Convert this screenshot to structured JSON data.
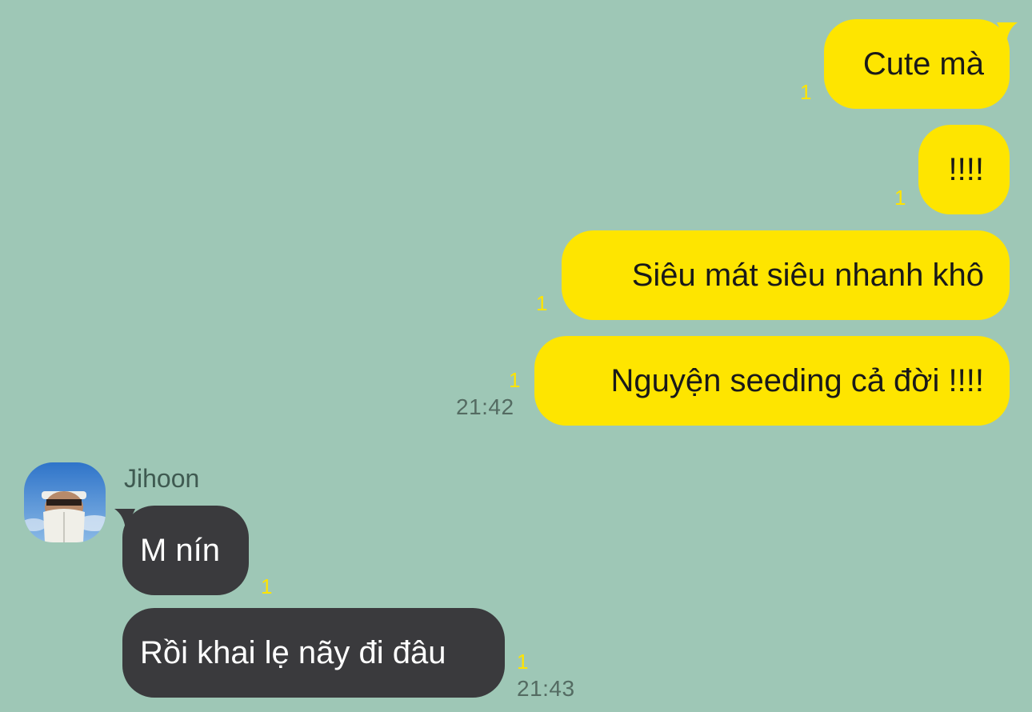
{
  "colors": {
    "background": "#9ec7b6",
    "outgoing_bubble": "#fee500",
    "incoming_bubble": "#3a3a3d",
    "read_count": "#ffe400",
    "timestamp": "#546b62"
  },
  "outgoing": [
    {
      "text": "Cute mà",
      "unread": "1"
    },
    {
      "text": "!!!!",
      "unread": "1"
    },
    {
      "text": "Siêu mát siêu nhanh khô",
      "unread": "1"
    },
    {
      "text": "Nguyện seeding cả đời !!!!",
      "unread": "1",
      "time": "21:42"
    }
  ],
  "contact": {
    "name": "Jihoon",
    "avatar_icon": "profile-photo"
  },
  "incoming": [
    {
      "text": "M nín",
      "unread": "1"
    },
    {
      "text": "Rồi khai lẹ nãy đi đâu",
      "unread": "1",
      "time": "21:43"
    }
  ]
}
